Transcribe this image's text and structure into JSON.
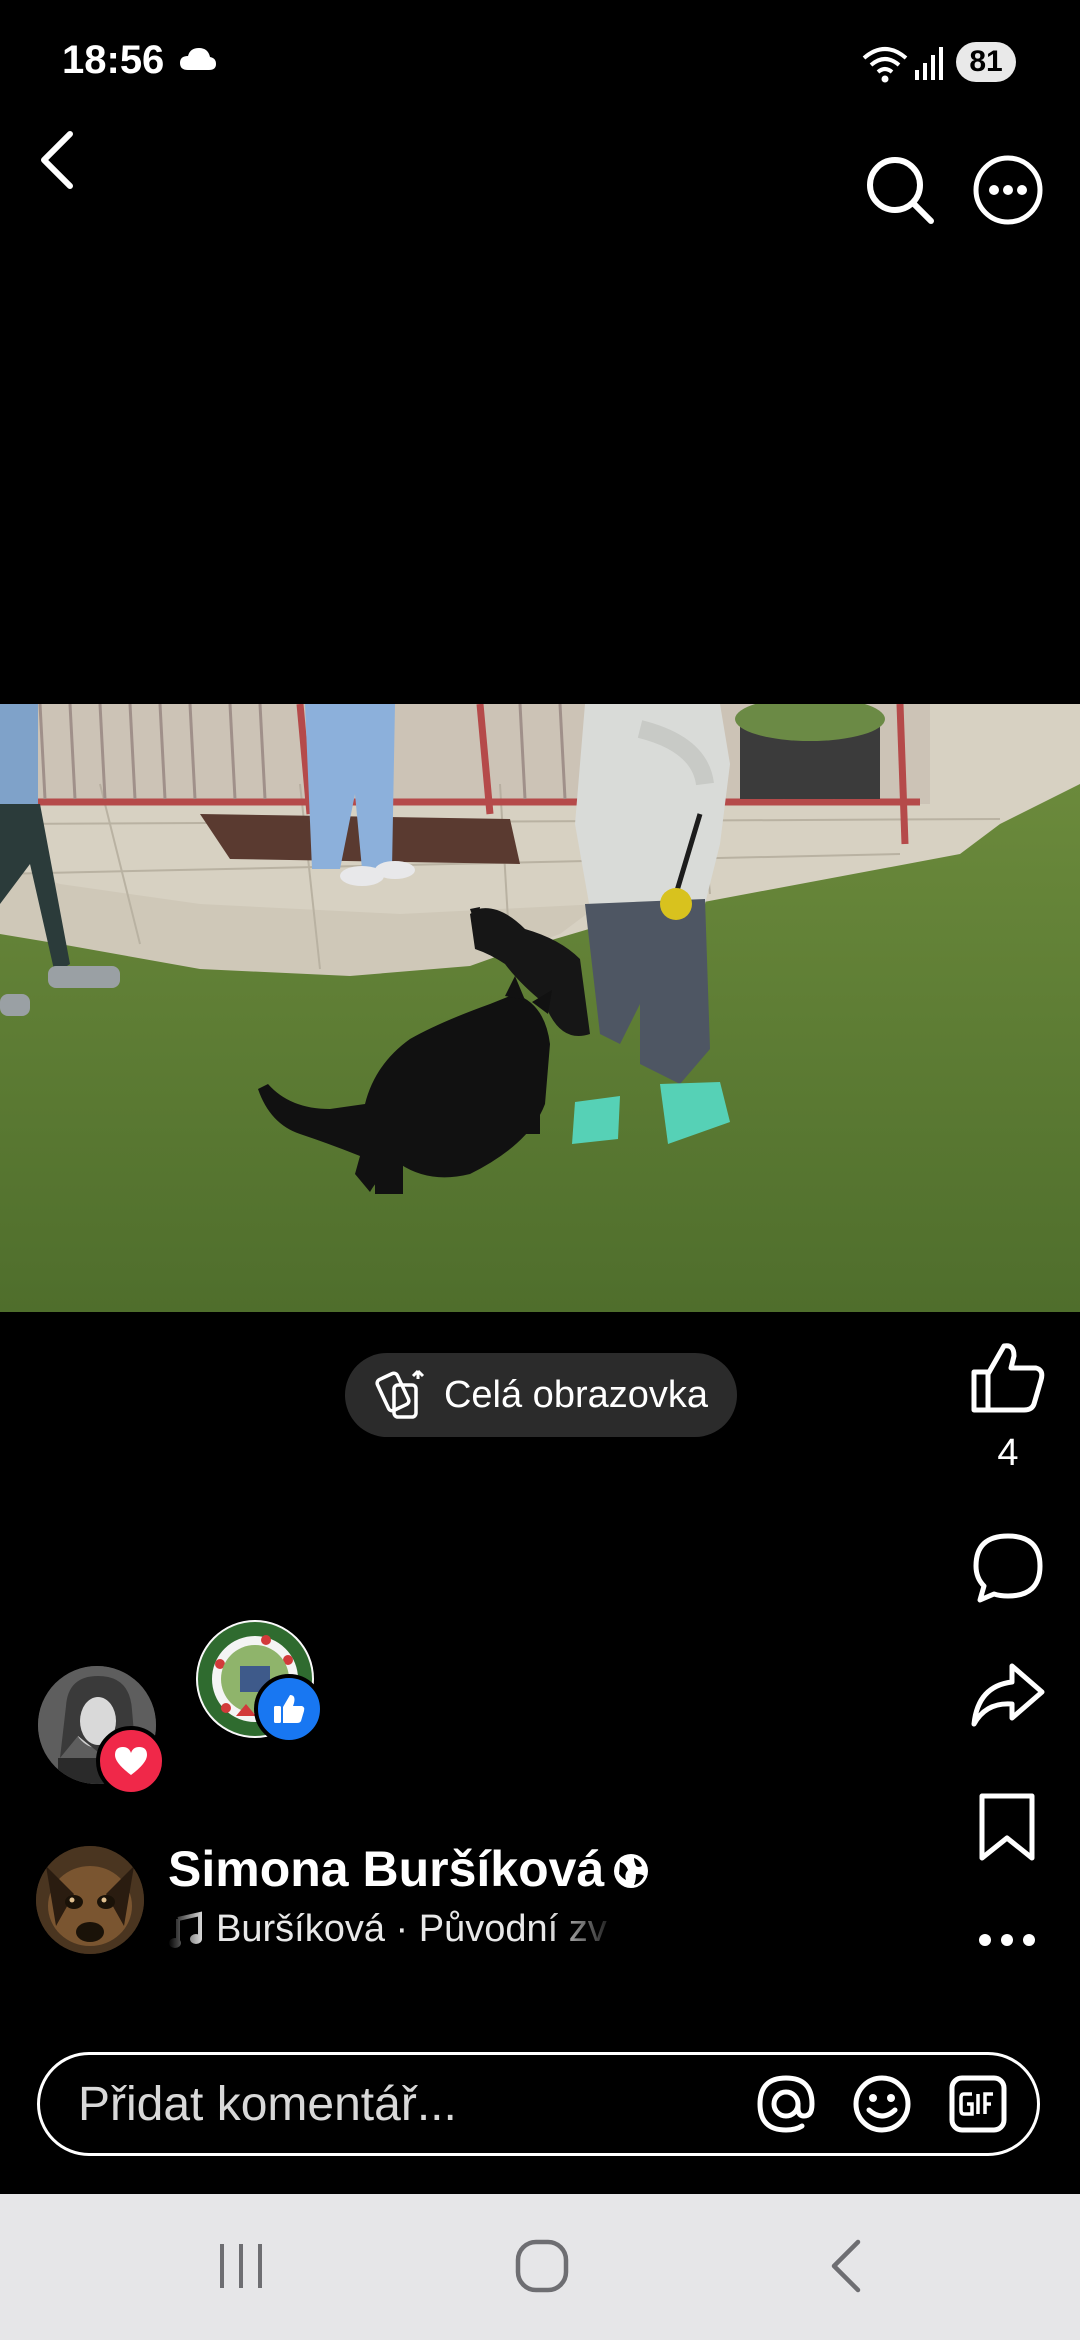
{
  "status_bar": {
    "time": "18:56",
    "battery": "81",
    "icons": [
      "cloud-icon",
      "wifi-icon",
      "signal-icon",
      "battery-icon"
    ]
  },
  "top_bar": {
    "icons": [
      "back-arrow-icon",
      "search-icon",
      "more-options-icon"
    ]
  },
  "video": {
    "fullscreen_label": "Celá obrazovka"
  },
  "side_actions": {
    "like_count": "4",
    "icons": [
      "thumbs-up-icon",
      "comment-icon",
      "share-icon",
      "bookmark-icon",
      "more-horizontal-icon"
    ]
  },
  "reactions": [
    {
      "type": "love",
      "icon": "heart-icon"
    },
    {
      "type": "like",
      "icon": "thumbs-up-icon"
    }
  ],
  "author": {
    "name": "Simona Buršíková",
    "audience_icon": "globe-icon",
    "audio": "Buršíková · Původní zv"
  },
  "comment_bar": {
    "placeholder": "Přidat komentář...",
    "icons": [
      "at-mention-icon",
      "emoji-icon",
      "gif-icon"
    ]
  },
  "colors": {
    "background": "#000000",
    "love_red": "#f02849",
    "like_blue": "#1877f2",
    "navbar": "#e6e6e8"
  }
}
